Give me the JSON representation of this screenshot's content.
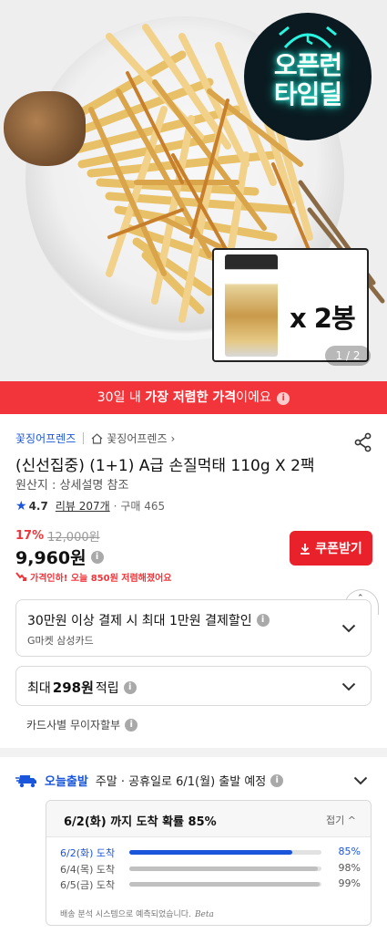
{
  "hero": {
    "timedeal_label": "오픈런\n타임딜",
    "pack_quantity": "x 2봉",
    "pager": "1 / 2",
    "image_pages": {
      "current": 1,
      "total": 2
    }
  },
  "banner": {
    "prefix": "30일 내 ",
    "highlight": "가장 저렴한 가격",
    "suffix": "이에요"
  },
  "product": {
    "shop_name": "꽃징어프렌즈",
    "shop_link": "꽃징어프렌즈",
    "title": "(신선집중) (1+1) A급 손질먹태 110g X 2팩",
    "origin": "원산지 : 상세설명 참조",
    "rating": "4.7",
    "reviews": "리뷰 207개",
    "purchases": "구매 465",
    "discount_rate": "17%",
    "original_price": "12,000원",
    "price": "9,960원",
    "price_drop": "가격인하! 오늘 850원 저렴해졌어요",
    "coupon_button": "쿠폰받기"
  },
  "benefits": {
    "card_discount": "30만원 이상 결제 시 최대 1만원 결제할인",
    "card_name": "G마켓 삼성카드",
    "points_prefix": "최대",
    "points_amount": "298원",
    "points_suffix": "적립",
    "installment": "카드사별 무이자할부"
  },
  "shipping": {
    "tag": "오늘출발",
    "text": "주말 · 공휴일로 6/1(월) 출발 예정",
    "probability_title": "6/2(화) 까지 도착 확률 85%",
    "fold_label": "접기",
    "rows": [
      {
        "day": "6/2(화) 도착",
        "pct_label": "85%",
        "pct": 85
      },
      {
        "day": "6/4(목) 도착",
        "pct_label": "98%",
        "pct": 98
      },
      {
        "day": "6/5(금) 도착",
        "pct_label": "99%",
        "pct": 99
      }
    ],
    "note": "배송 분석 시스템으로 예측되었습니다.",
    "beta": "Beta"
  },
  "colors": {
    "accent_red": "#f2353a",
    "accent_blue": "#1a56db",
    "neon": "#2af5e0"
  }
}
